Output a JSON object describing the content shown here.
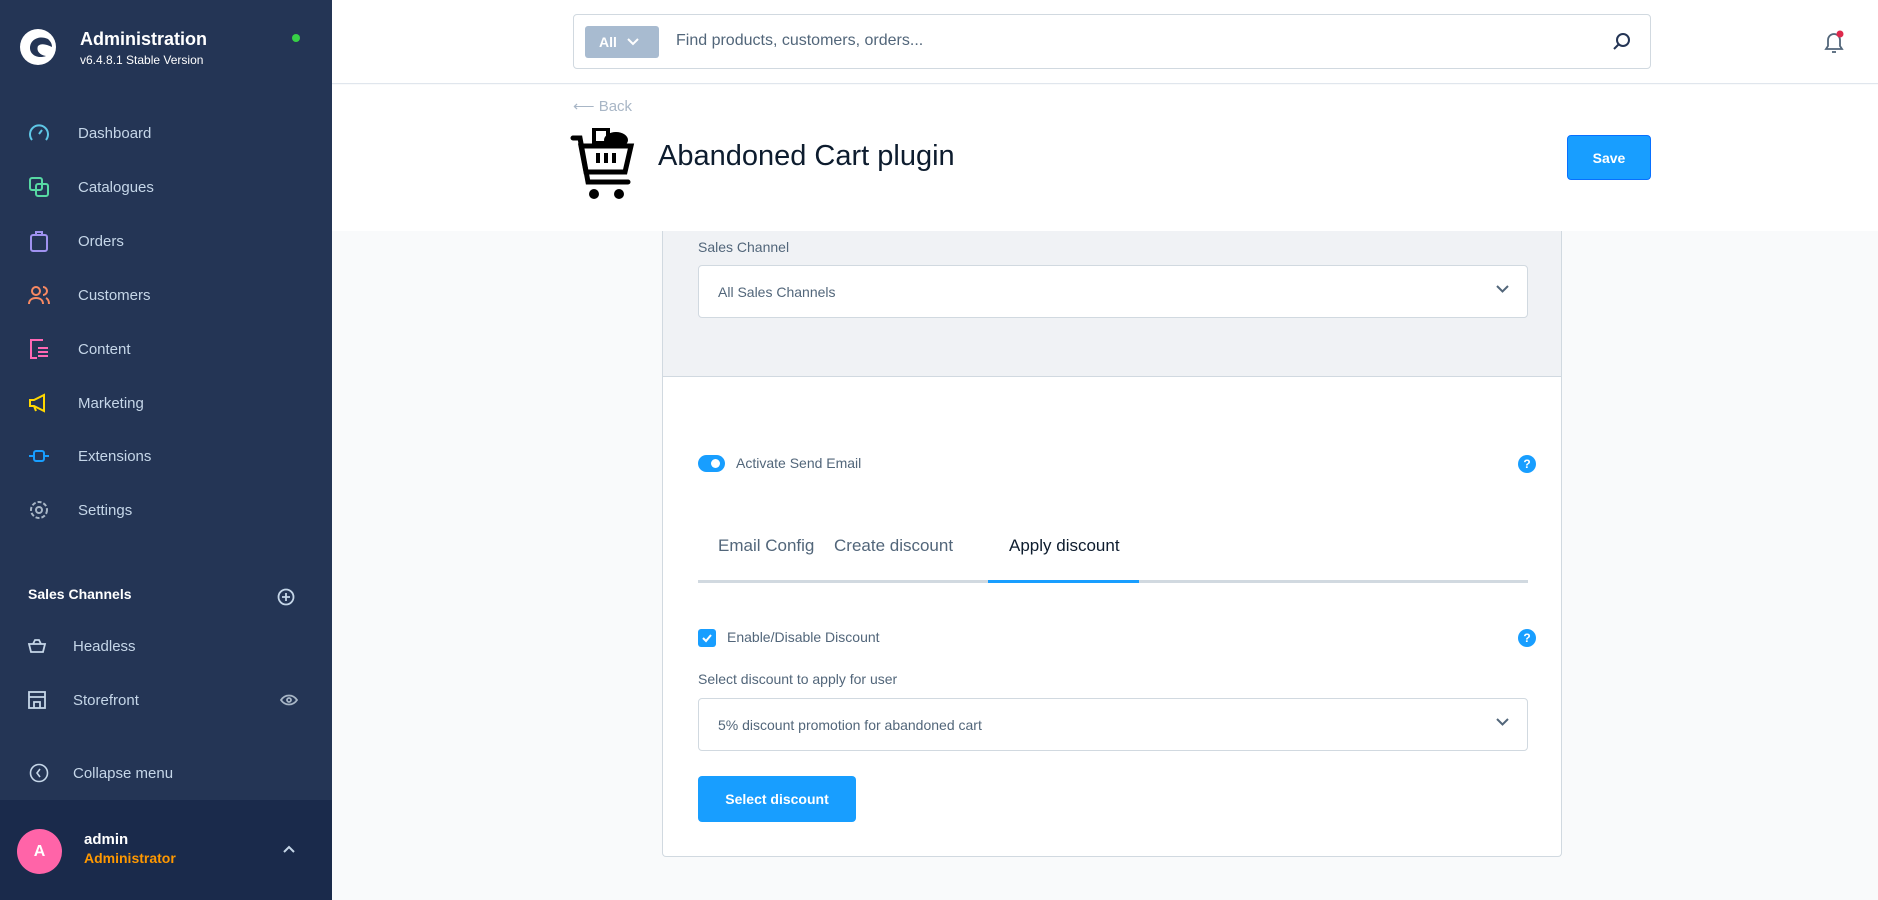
{
  "app": {
    "title": "Administration",
    "version": "v6.4.8.1 Stable Version"
  },
  "sidebar": {
    "items": [
      {
        "label": "Dashboard",
        "icon": "gauge-icon",
        "color": "#5fc7e6"
      },
      {
        "label": "Catalogues",
        "icon": "catalogue-icon",
        "color": "#57d9a3"
      },
      {
        "label": "Orders",
        "icon": "bag-icon",
        "color": "#a092f0"
      },
      {
        "label": "Customers",
        "icon": "users-icon",
        "color": "#f88962"
      },
      {
        "label": "Content",
        "icon": "content-icon",
        "color": "#ff68b4"
      },
      {
        "label": "Marketing",
        "icon": "megaphone-icon",
        "color": "#ffd700"
      },
      {
        "label": "Extensions",
        "icon": "plug-icon",
        "color": "#189eff"
      },
      {
        "label": "Settings",
        "icon": "gear-icon",
        "color": "#a8b6c6"
      }
    ],
    "sales_channels_title": "Sales Channels",
    "sales_channels": [
      {
        "label": "Headless"
      },
      {
        "label": "Storefront"
      }
    ],
    "collapse": "Collapse menu",
    "user": {
      "initial": "A",
      "name": "admin",
      "role": "Administrator"
    }
  },
  "search": {
    "scope": "All",
    "placeholder": "Find products, customers, orders..."
  },
  "header": {
    "back": "Back",
    "title": "Abandoned Cart plugin",
    "save": "Save"
  },
  "form": {
    "sales_channel_label": "Sales Channel",
    "sales_channel_value": "All Sales Channels",
    "activate_label": "Activate Send Email",
    "activate_on": true,
    "tabs": [
      "Email Config",
      "Create discount",
      "Apply discount"
    ],
    "active_tab": "Apply discount",
    "enable_label": "Enable/Disable Discount",
    "enable_checked": true,
    "discount_label": "Select discount to apply for user",
    "discount_value": "5% discount promotion for abandoned cart",
    "select_button": "Select discount",
    "help": "?"
  },
  "colors": {
    "accent": "#189eff",
    "sidebar": "#243555"
  }
}
